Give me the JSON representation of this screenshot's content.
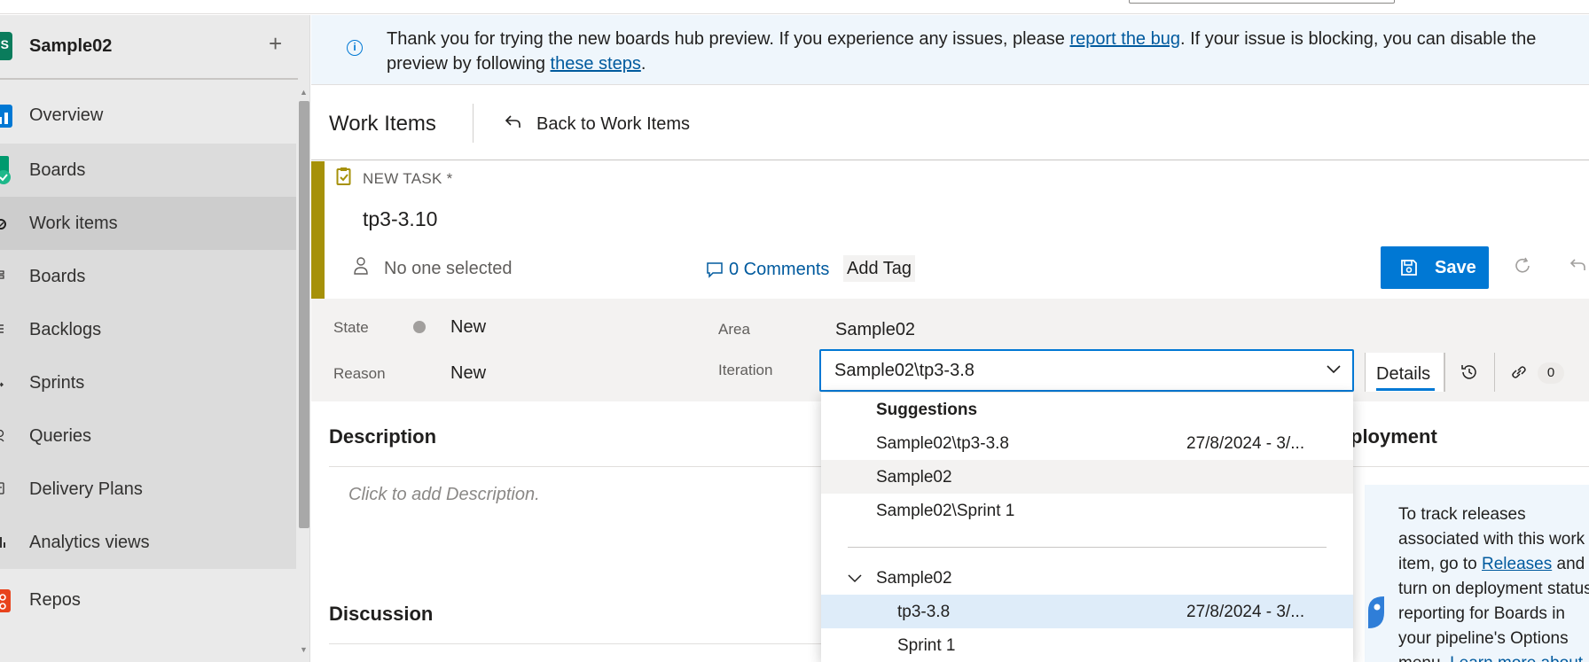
{
  "sidebar": {
    "project": {
      "initial": "S",
      "name": "Sample02",
      "add_label": "+"
    },
    "items": [
      {
        "label": "Overview",
        "icon": "overview-icon"
      },
      {
        "label": "Boards",
        "icon": "boards-icon"
      },
      {
        "label": "Work items",
        "icon": "work-items-icon"
      },
      {
        "label": "Boards",
        "icon": "board-icon"
      },
      {
        "label": "Backlogs",
        "icon": "backlogs-icon"
      },
      {
        "label": "Sprints",
        "icon": "sprints-icon"
      },
      {
        "label": "Queries",
        "icon": "queries-icon"
      },
      {
        "label": "Delivery Plans",
        "icon": "delivery-plans-icon"
      },
      {
        "label": "Analytics views",
        "icon": "analytics-icon"
      },
      {
        "label": "Repos",
        "icon": "repos-icon"
      }
    ]
  },
  "banner": {
    "icon": "info-icon",
    "text_before": "Thank you for trying the new boards hub preview. If you experience any issues, please ",
    "link1": "report the bug",
    "text_middle": ". If your issue is blocking, you can disable the preview by following ",
    "link2": "these steps",
    "text_after": "."
  },
  "breadcrumb": {
    "title": "Work Items",
    "back_label": "Back to Work Items"
  },
  "work_item": {
    "type": "NEW TASK *",
    "title": "tp3-3.10",
    "assigned": "No one selected",
    "comments": "0 Comments",
    "add_tag": "Add Tag",
    "save_label": "Save"
  },
  "fields": {
    "state_label": "State",
    "state_value": "New",
    "reason_label": "Reason",
    "reason_value": "New",
    "area_label": "Area",
    "area_value": "Sample02",
    "iteration_label": "Iteration",
    "iteration_value": "Sample02\\tp3-3.8"
  },
  "tabs": {
    "details": "Details",
    "links_count": "0"
  },
  "sections": {
    "description": "Description",
    "description_placeholder": "Click to add Description.",
    "discussion": "Discussion",
    "deployment": "ployment"
  },
  "deployment": {
    "text_before": "To track releases associated with this work item, go to ",
    "link": "Releases",
    "text_after": " and turn on deployment status reporting for Boards in your pipeline's Options menu. ",
    "learn_more": "Learn more about"
  },
  "dropdown": {
    "suggestions_header": "Suggestions",
    "suggestions": [
      {
        "name": "Sample02\\tp3-3.8",
        "date": "27/8/2024 - 3/..."
      },
      {
        "name": "Sample02",
        "date": ""
      },
      {
        "name": "Sample02\\Sprint 1",
        "date": ""
      }
    ],
    "tree_root": "Sample02",
    "tree_children": [
      {
        "name": "tp3-3.8",
        "date": "27/8/2024 - 3/..."
      },
      {
        "name": "Sprint 1",
        "date": ""
      }
    ]
  },
  "colors": {
    "accent": "#0078d4",
    "task_accent": "#a69109",
    "link": "#005a9e"
  }
}
